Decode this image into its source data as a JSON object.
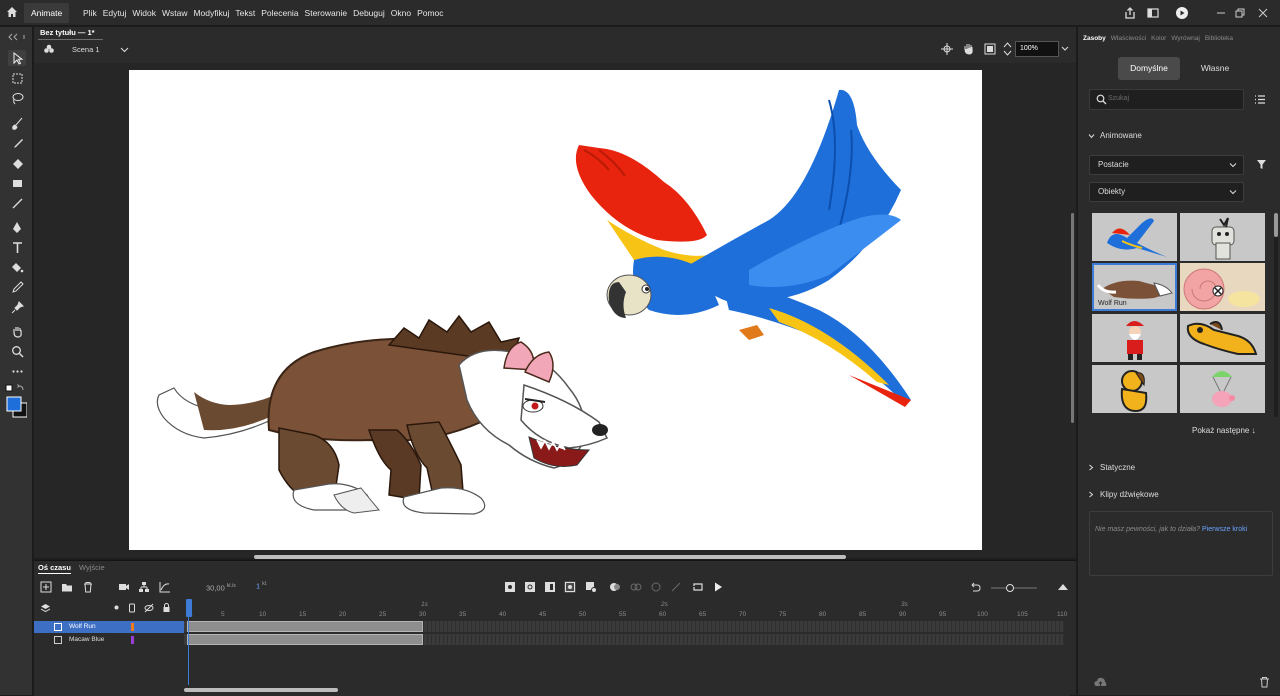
{
  "app": {
    "name": "Animate"
  },
  "menu": [
    "Plik",
    "Edytuj",
    "Widok",
    "Wstaw",
    "Modyfikuj",
    "Tekst",
    "Polecenia",
    "Sterowanie",
    "Debuguj",
    "Okno",
    "Pomoc"
  ],
  "document": {
    "tab": "Bez tytułu — 1*",
    "scene": "Scena 1",
    "zoom": "100%"
  },
  "tools": [
    "selection-tool",
    "free-transform-tool",
    "lasso-tool",
    "paint-brush-tool",
    "brush-tool",
    "eraser-tool",
    "rectangle-tool",
    "line-tool",
    "pen-tool",
    "text-tool",
    "paint-bucket-tool",
    "eyedropper-tool",
    "pin-tool",
    "hand-tool",
    "zoom-tool",
    "more-tools"
  ],
  "colors": {
    "stroke": "#111111",
    "fill": "#1e6fd9",
    "accent": "#3d7bd6"
  },
  "timeline": {
    "tabs": [
      "Oś czasu",
      "Wyjście"
    ],
    "fps": "30,00",
    "fps_unit": "kl./s",
    "current_frame": "1",
    "frame_unit": "kl.",
    "seconds": [
      "1s",
      "2s",
      "3s"
    ],
    "ticks": [
      "1",
      "5",
      "10",
      "15",
      "20",
      "25",
      "30",
      "35",
      "40",
      "45",
      "50",
      "55",
      "60",
      "65",
      "70",
      "75",
      "80",
      "85",
      "90",
      "95",
      "100",
      "105",
      "110"
    ],
    "layers": [
      {
        "name": "Wolf Run",
        "color": "#f07a1a",
        "selected": true,
        "frames": 30
      },
      {
        "name": "Macaw Blue",
        "color": "#9a3ed6",
        "selected": false,
        "frames": 30
      }
    ]
  },
  "assets_panel": {
    "tabs": [
      "Zasoby",
      "Właściwości",
      "Kolor",
      "Wyrównaj",
      "Biblioteka"
    ],
    "segments": [
      "Domyślne",
      "Własne"
    ],
    "search_placeholder": "Szukaj",
    "section_animated": "Animowane",
    "category": "Postacie",
    "subcategory": "Obiekty",
    "thumb_selected_caption": "Wolf Run",
    "show_more": "Pokaż następne ↓",
    "section_static": "Statyczne",
    "section_sound": "Klipy dźwiękowe",
    "help_text": "Nie masz pewności, jak to działa?",
    "help_link": "Pierwsze kroki"
  }
}
